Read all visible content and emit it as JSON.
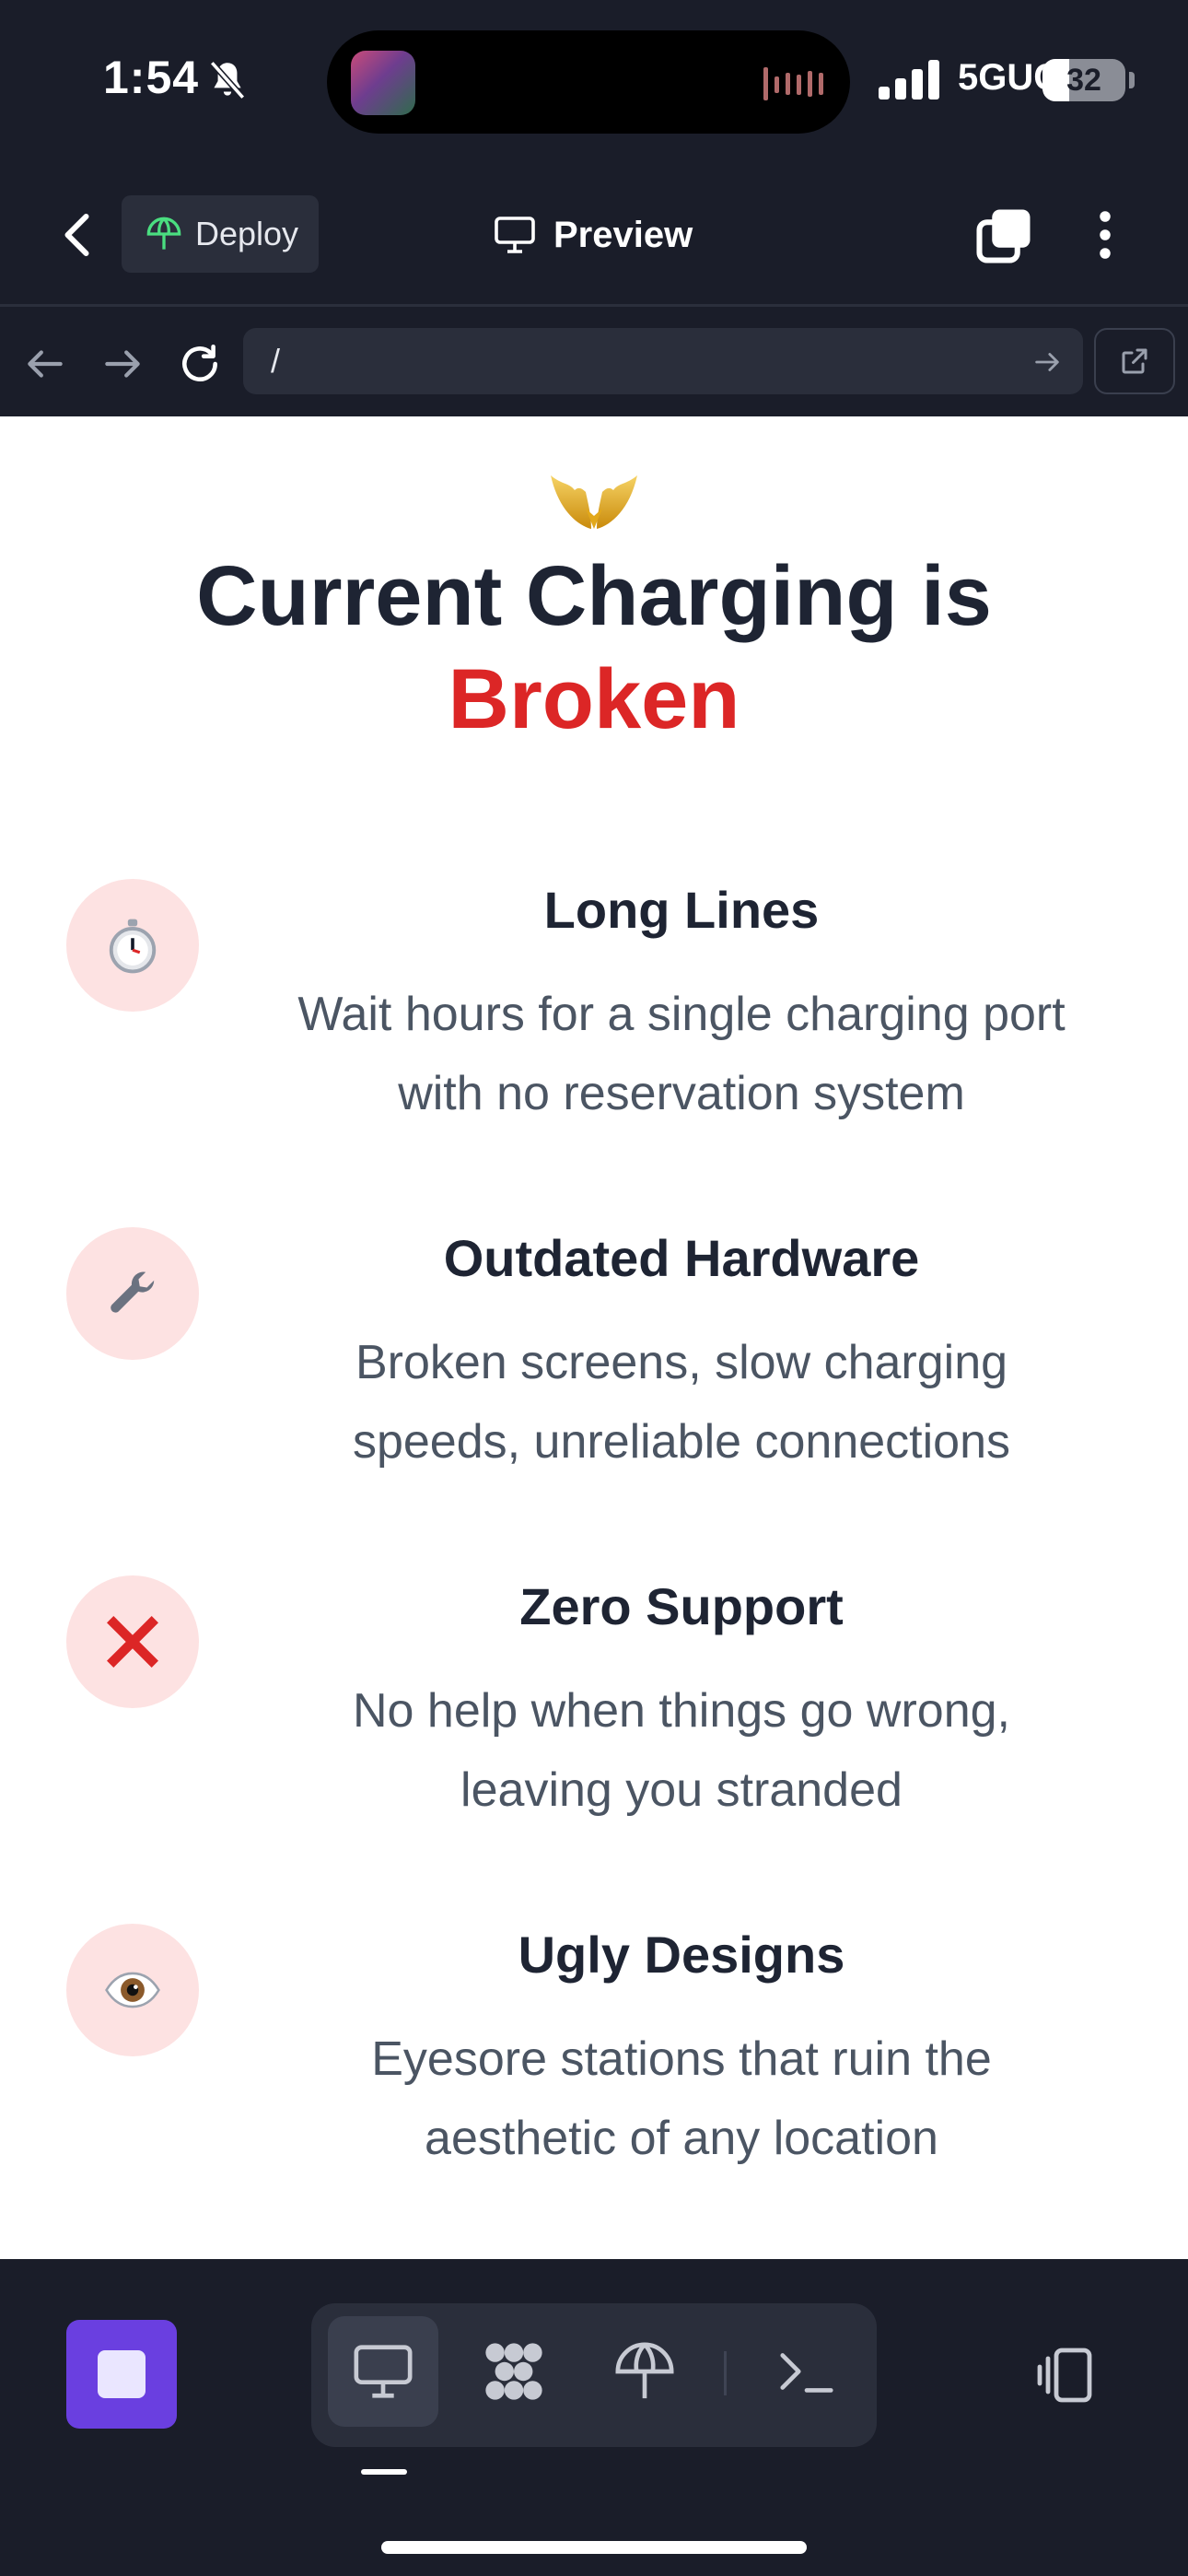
{
  "status_bar": {
    "time": "1:54",
    "network": "5GUC",
    "battery": "32",
    "battery_level": 0.32
  },
  "header": {
    "deploy_label": "Deploy",
    "title": "Preview"
  },
  "address_bar": {
    "url": "/"
  },
  "hero": {
    "line1": "Current Charging is",
    "line2": "Broken",
    "accent_color": "#dc2626"
  },
  "problems": [
    {
      "icon": "stopwatch-icon",
      "title": "Long Lines",
      "desc_lines": [
        "Wait hours for a single charging port",
        "with no reservation system"
      ]
    },
    {
      "icon": "wrench-icon",
      "title": "Outdated Hardware",
      "desc_lines": [
        "Broken screens, slow charging",
        "speeds, unreliable connections"
      ]
    },
    {
      "icon": "cross-mark-icon",
      "title": "Zero Support",
      "desc_lines": [
        "No help when things go wrong,",
        "leaving you stranded"
      ]
    },
    {
      "icon": "eye-icon",
      "title": "Ugly Designs",
      "desc_lines": [
        "Eyesore stations that ruin the",
        "aesthetic of any location"
      ]
    }
  ],
  "bottom_bar": {
    "tools": [
      "monitor-icon",
      "grid-blob-icon",
      "umbrella-icon",
      "terminal-icon"
    ],
    "active_tool": "monitor-icon"
  },
  "colors": {
    "chrome_bg": "#1a1d29",
    "stop_button": "#6a3fe0",
    "icon_circle_bg": "#fde2e2"
  }
}
